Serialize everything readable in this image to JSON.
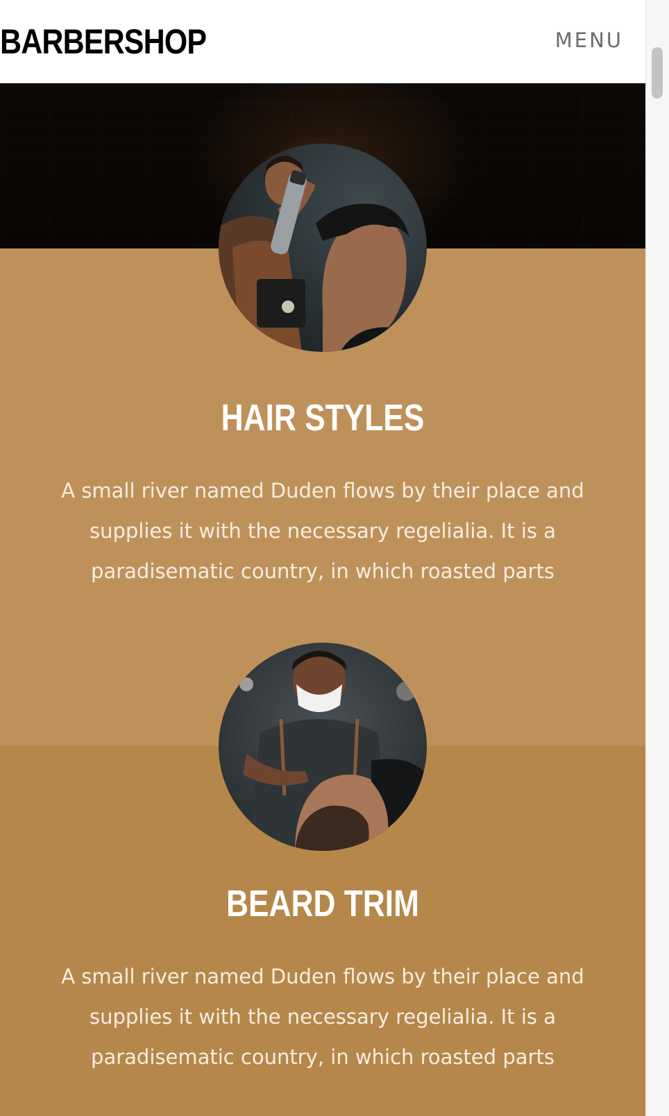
{
  "navbar": {
    "brand": "BARBERSHOP",
    "menu_label": "MENU"
  },
  "services": [
    {
      "title": "HAIR STYLES",
      "description": "A small river named Duden flows by their place and supplies it with the necessary regelialia. It is a paradisematic country, in which roasted parts",
      "photo_icon": "barber-styling-hair-photo"
    },
    {
      "title": "BEARD TRIM",
      "description": "A small river named Duden flows by their place and supplies it with the necessary regelialia. It is a paradisematic country, in which roasted parts",
      "photo_icon": "barber-beard-trim-photo"
    }
  ],
  "colors": {
    "hair_section_bg": "#bf915a",
    "beard_section_bg": "#b6874a",
    "hero_bg": "#0a0705",
    "title_text": "#ffffff",
    "body_text": "#f7ede2",
    "menu_text": "#6b6b6b"
  }
}
